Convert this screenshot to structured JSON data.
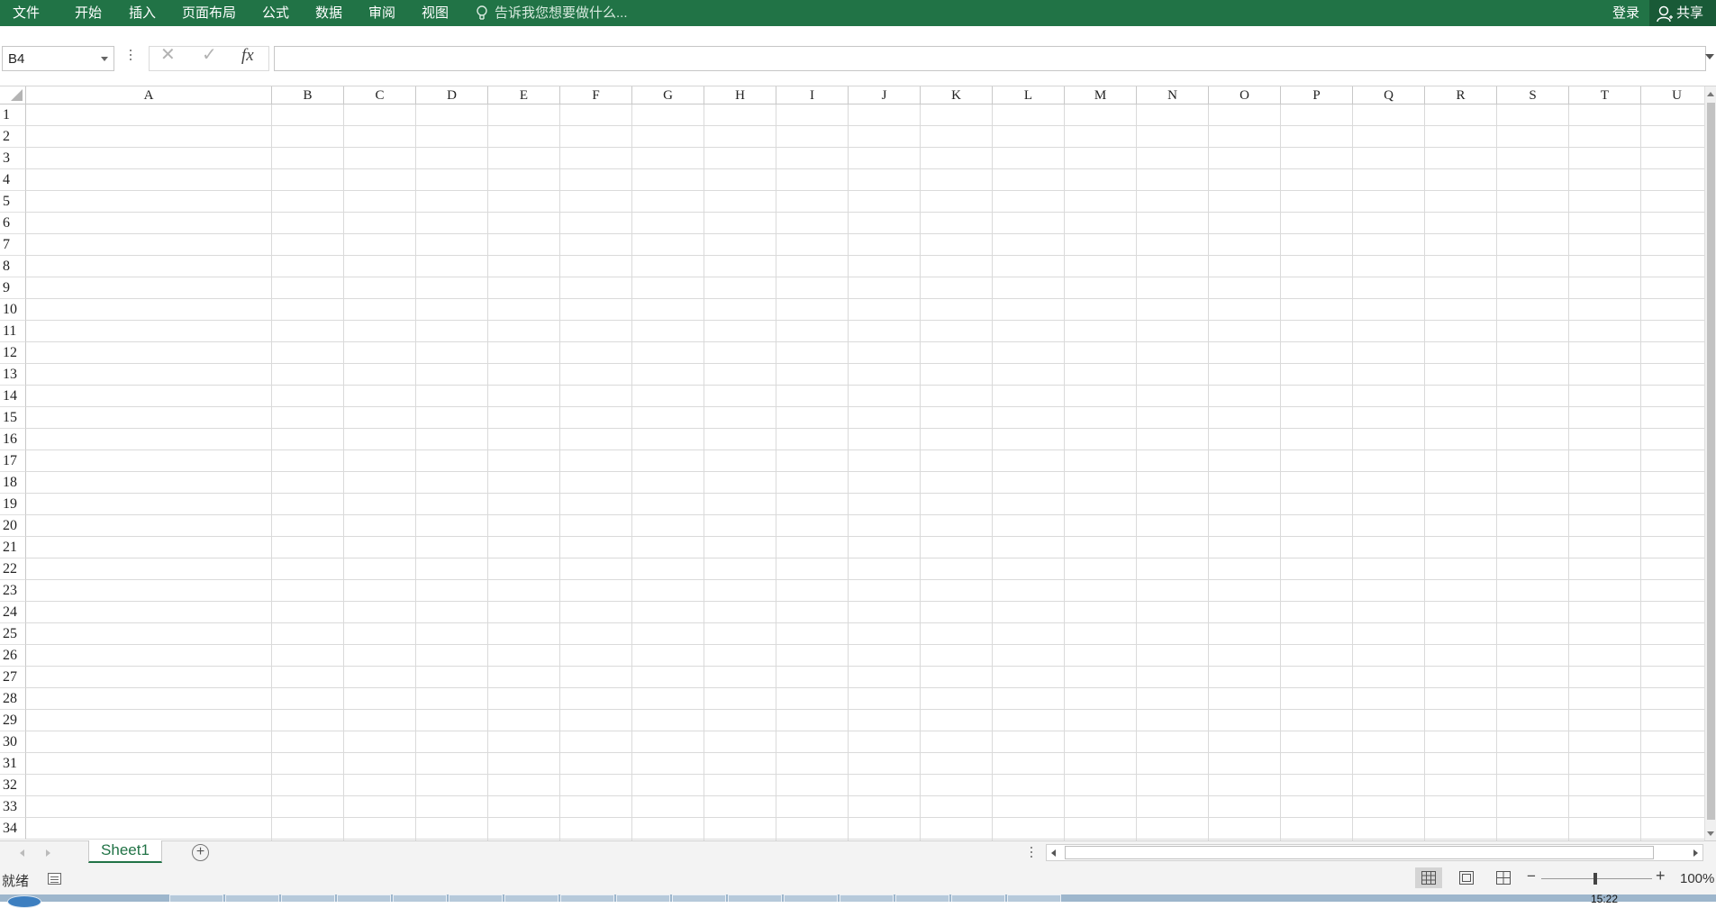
{
  "ribbon": {
    "tabs": [
      "文件",
      "开始",
      "插入",
      "页面布局",
      "公式",
      "数据",
      "审阅",
      "视图"
    ],
    "tell_me": "告诉我您想要做什么...",
    "login": "登录",
    "share": "共享"
  },
  "formula_bar": {
    "name_box": "B4",
    "formula": "",
    "fx": "fx"
  },
  "grid": {
    "columns": [
      "A",
      "B",
      "C",
      "D",
      "E",
      "F",
      "G",
      "H",
      "I",
      "J",
      "K",
      "L",
      "M",
      "N",
      "O",
      "P",
      "Q",
      "R",
      "S",
      "T",
      "U"
    ],
    "rows": [
      "1",
      "2",
      "3",
      "4",
      "5",
      "6",
      "7",
      "8",
      "9",
      "10",
      "11",
      "12",
      "13",
      "14",
      "15",
      "16",
      "17",
      "18",
      "19",
      "20",
      "21",
      "22",
      "23",
      "24",
      "25",
      "26",
      "27",
      "28",
      "29",
      "30",
      "31",
      "32",
      "33",
      "34"
    ]
  },
  "sheets": {
    "tabs": [
      "Sheet1"
    ],
    "active": "Sheet1"
  },
  "status_bar": {
    "status": "就绪",
    "zoom": "100%"
  },
  "taskbar": {
    "time": "15:22"
  },
  "colors": {
    "ribbon": "#217346",
    "active_sheet": "#217346"
  }
}
